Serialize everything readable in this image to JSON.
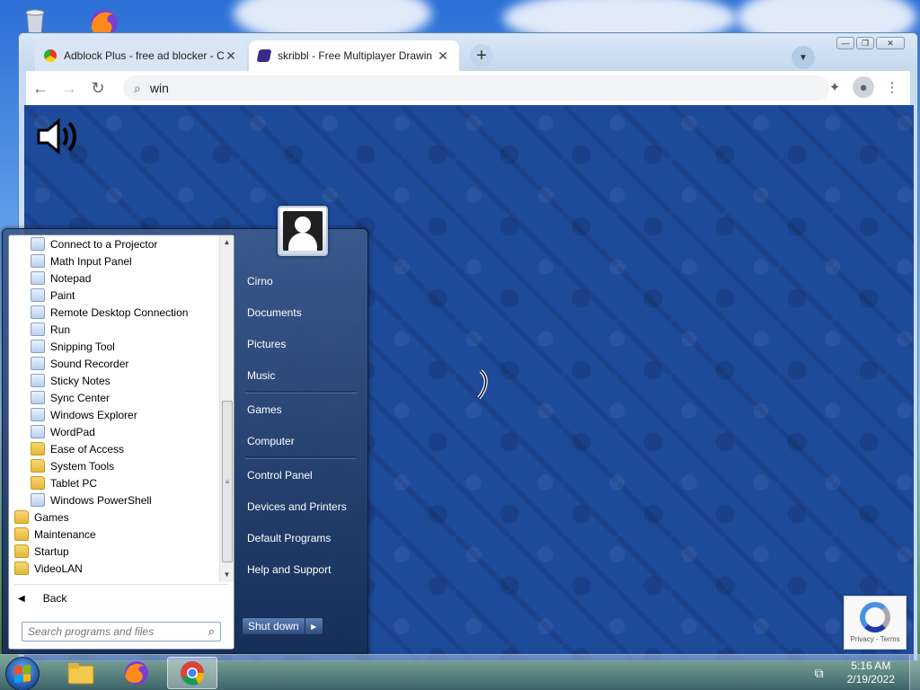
{
  "browser": {
    "tabs": [
      {
        "title": "Adblock Plus - free ad blocker - C",
        "active": false
      },
      {
        "title": "skribbl - Free Multiplayer Drawin",
        "active": true
      }
    ],
    "address": "win",
    "icons": {
      "back": "arrow-left-icon",
      "forward": "arrow-right-icon",
      "reload": "reload-icon",
      "extensions": "puzzle-icon",
      "profile": "person-icon",
      "menu": "kebab-menu-icon"
    }
  },
  "page": {
    "recaptcha_label": "Privacy - Terms"
  },
  "start_menu": {
    "programs": [
      {
        "label": "Connect to a Projector",
        "type": "app"
      },
      {
        "label": "Math Input Panel",
        "type": "app"
      },
      {
        "label": "Notepad",
        "type": "app"
      },
      {
        "label": "Paint",
        "type": "app"
      },
      {
        "label": "Remote Desktop Connection",
        "type": "app"
      },
      {
        "label": "Run",
        "type": "app"
      },
      {
        "label": "Snipping Tool",
        "type": "app"
      },
      {
        "label": "Sound Recorder",
        "type": "app"
      },
      {
        "label": "Sticky Notes",
        "type": "app"
      },
      {
        "label": "Sync Center",
        "type": "app"
      },
      {
        "label": "Windows Explorer",
        "type": "app"
      },
      {
        "label": "WordPad",
        "type": "app"
      },
      {
        "label": "Ease of Access",
        "type": "folder"
      },
      {
        "label": "System Tools",
        "type": "folder"
      },
      {
        "label": "Tablet PC",
        "type": "folder"
      },
      {
        "label": "Windows PowerShell",
        "type": "app"
      },
      {
        "label": "Games",
        "type": "folder-root"
      },
      {
        "label": "Maintenance",
        "type": "folder-root"
      },
      {
        "label": "Startup",
        "type": "folder-root"
      },
      {
        "label": "VideoLAN",
        "type": "folder-root"
      }
    ],
    "back_label": "Back",
    "search_placeholder": "Search programs and files",
    "right_links": [
      [
        "Cirno",
        "Documents",
        "Pictures",
        "Music"
      ],
      [
        "Games",
        "Computer"
      ],
      [
        "Control Panel",
        "Devices and Printers",
        "Default Programs",
        "Help and Support"
      ]
    ],
    "shutdown_label": "Shut down"
  },
  "taskbar": {
    "time": "5:16 AM",
    "date": "2/19/2022",
    "apps": [
      "file-explorer-icon",
      "firefox-icon",
      "chrome-icon"
    ]
  }
}
